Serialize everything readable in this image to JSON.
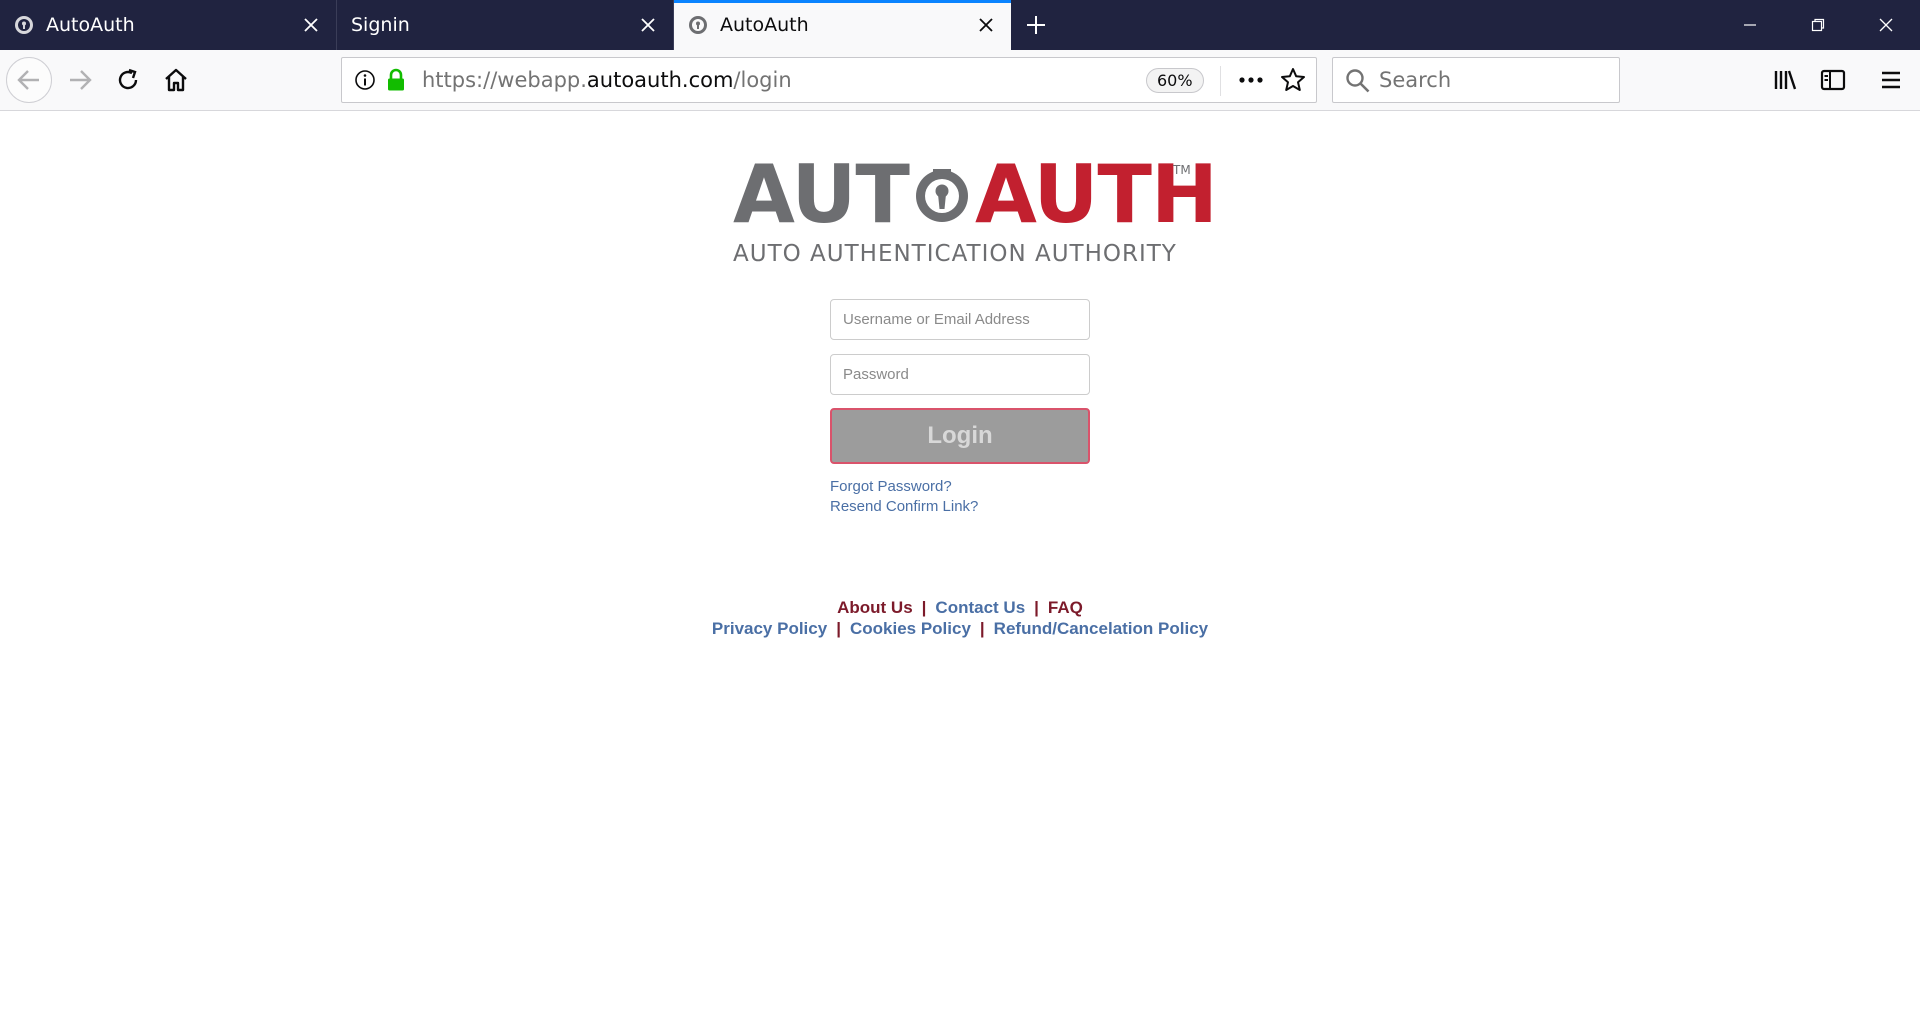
{
  "tabs": [
    {
      "title": "AutoAuth",
      "active": false
    },
    {
      "title": "Signin",
      "active": false
    },
    {
      "title": "AutoAuth",
      "active": true
    }
  ],
  "navbar": {
    "url_prefix": "https://webapp.",
    "url_host": "autoauth.com",
    "url_path": "/login",
    "zoom": "60%",
    "search_placeholder": "Search"
  },
  "page": {
    "logo": {
      "auto_text": "AUT",
      "auth_text": "AUTH",
      "tm": "TM",
      "tagline": "AUTO AUTHENTICATION AUTHORITY"
    },
    "form": {
      "username_placeholder": "Username or Email Address",
      "password_placeholder": "Password",
      "login_label": "Login",
      "forgot_label": "Forgot Password?",
      "resend_label": "Resend Confirm Link?"
    },
    "footer": {
      "about": "About Us",
      "contact": "Contact Us",
      "faq": "FAQ",
      "privacy": "Privacy Policy",
      "cookies": "Cookies Policy",
      "refund": "Refund/Cancelation Policy",
      "separator": "|"
    }
  },
  "colors": {
    "tabbar_bg": "#202340",
    "active_tab_accent": "#0a84ff",
    "brand_gray": "#6d6e71",
    "brand_red": "#c2202f",
    "link_blue": "#4a6fa5",
    "link_dark_red": "#7c1a2a",
    "lock_green": "#12bc00"
  }
}
